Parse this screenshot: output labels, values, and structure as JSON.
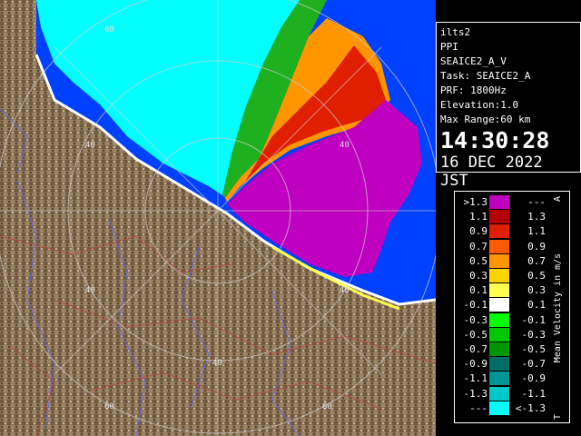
{
  "info": {
    "site": "ilts2",
    "mode": "PPI",
    "product": "SEAICE2_A_V",
    "task": "Task: SEAICE2_A",
    "prf": "PRF: 1800Hz",
    "elevation": "Elevation:1.0",
    "max_range": "Max Range:60 km",
    "time": "14:30:28",
    "date": "16 DEC 2022 JST"
  },
  "legend": {
    "title": "Mean Velocity in m/s",
    "top_marker": "A",
    "bottom_marker": "T",
    "rows": [
      {
        "left": ">1.3",
        "right": "---",
        "color": "#c000c0"
      },
      {
        "left": "1.1",
        "right": "1.3",
        "color": "#b40000"
      },
      {
        "left": "0.9",
        "right": "1.1",
        "color": "#e01e00"
      },
      {
        "left": "0.7",
        "right": "0.9",
        "color": "#ff5a00"
      },
      {
        "left": "0.5",
        "right": "0.7",
        "color": "#ff9600"
      },
      {
        "left": "0.3",
        "right": "0.5",
        "color": "#ffd200"
      },
      {
        "left": "0.1",
        "right": "0.3",
        "color": "#ffff50"
      },
      {
        "left": "-0.1",
        "right": "0.1",
        "color": "#ffffff"
      },
      {
        "left": "-0.3",
        "right": "-0.1",
        "color": "#00ff00"
      },
      {
        "left": "-0.5",
        "right": "-0.3",
        "color": "#00c800"
      },
      {
        "left": "-0.7",
        "right": "-0.5",
        "color": "#009600"
      },
      {
        "left": "-0.9",
        "right": "-0.7",
        "color": "#006e64"
      },
      {
        "left": "-1.1",
        "right": "-0.9",
        "color": "#009696"
      },
      {
        "left": "-1.3",
        "right": "-1.1",
        "color": "#00c8c8"
      },
      {
        "left": "---",
        "right": "<-1.3",
        "color": "#00ffff"
      }
    ]
  },
  "map": {
    "range_labels": [
      "60",
      "40",
      "40",
      "40",
      "40",
      "60",
      "60"
    ],
    "colors": {
      "land": "#8b7355",
      "sea_no_data": "#0040ff",
      "outgoing_strong": "#c000c0",
      "incoming_strong": "#00ffff",
      "coast": "#ffffff"
    }
  }
}
